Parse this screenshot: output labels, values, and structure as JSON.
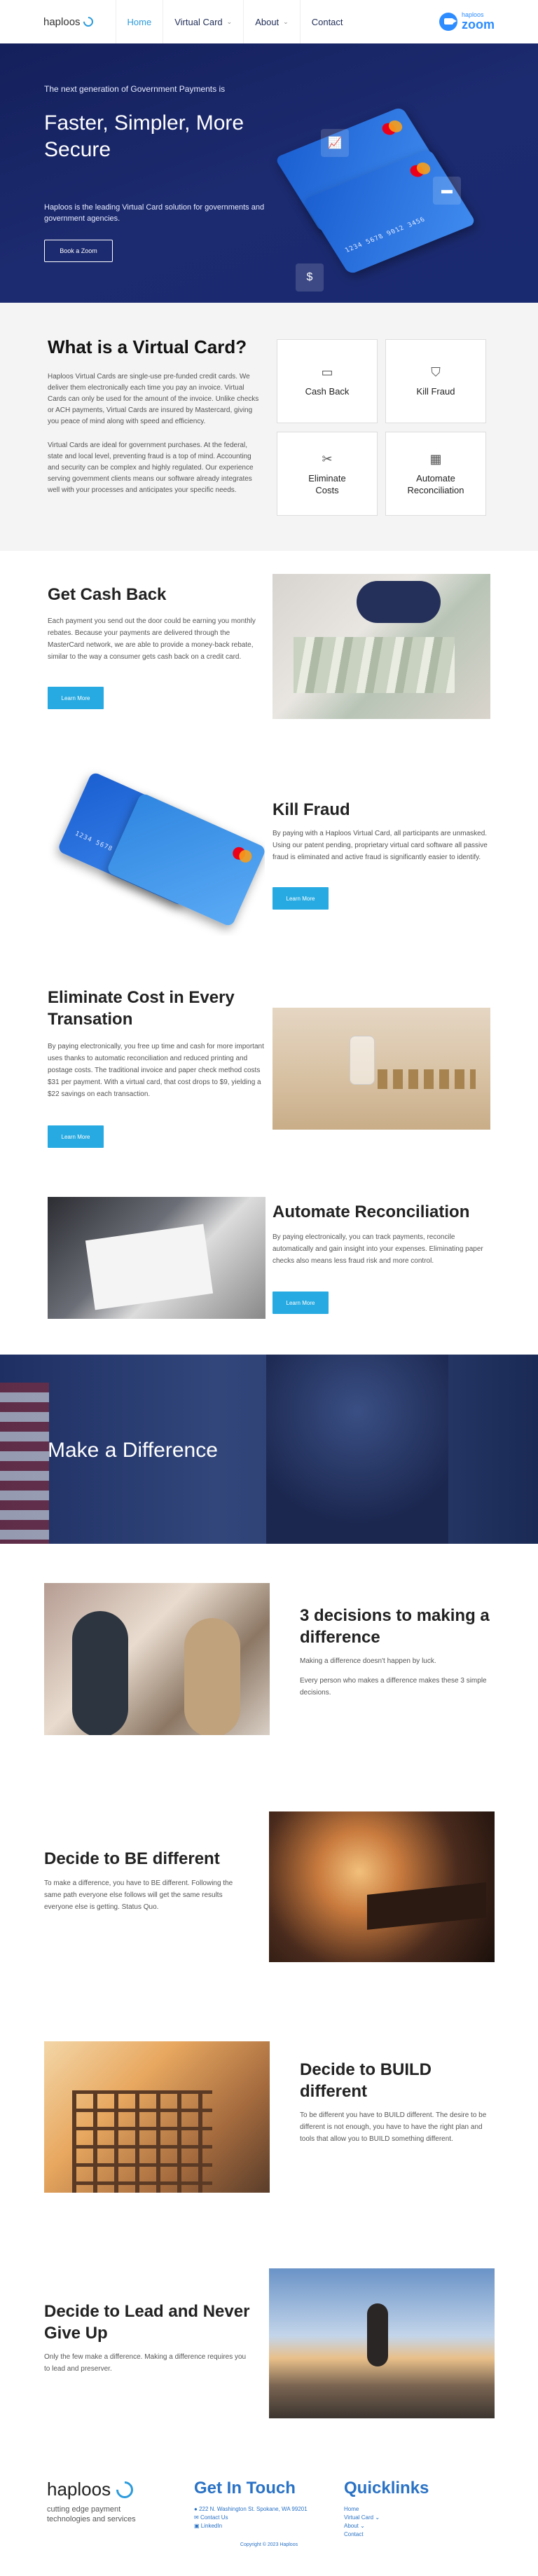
{
  "header": {
    "logo_text": "haploos",
    "nav": [
      {
        "label": "Home",
        "active": true,
        "dropdown": false
      },
      {
        "label": "Virtual Card",
        "active": false,
        "dropdown": true
      },
      {
        "label": "About",
        "active": false,
        "dropdown": true
      },
      {
        "label": "Contact",
        "active": false,
        "dropdown": false
      }
    ],
    "zoom": {
      "small": "haploos",
      "big": "zoom"
    }
  },
  "hero": {
    "eyebrow": "The next generation of Government Payments is",
    "title": "Faster, Simpler, More Secure",
    "description": "Haploos is the leading Virtual Card solution for governments and government agencies.",
    "button": "Book a Zoom",
    "card_number": "1234 5678 9012 3456"
  },
  "what": {
    "title": "What is a Virtual Card?",
    "p1": "Haploos Virtual Cards are single-use pre-funded credit cards. We deliver them electronically each time you pay an invoice. Virtual Cards can only be used for the amount of the invoice. Unlike checks or ACH payments, Virtual Cards are insured by Mastercard, giving you peace of mind along with speed and efficiency.",
    "p2": "Virtual Cards are ideal for government purchases. At the federal, state and local level, preventing fraud is a top of mind. Accounting and security can be complex and highly regulated. Our experience serving government clients means our software already integrates well with your processes and anticipates your specific needs.",
    "features": [
      {
        "label": "Cash Back",
        "icon": "card-icon"
      },
      {
        "label": "Kill Fraud",
        "icon": "shield-icon"
      },
      {
        "label": "Eliminate Costs",
        "icon": "scissors-icon"
      },
      {
        "label": "Automate Reconciliation",
        "icon": "ledger-icon"
      }
    ]
  },
  "cashback": {
    "title": "Get Cash Back",
    "text": "Each payment you send out the door could be earning you monthly rebates. Because your payments are delivered through the MasterCard network, we are able to provide a money-back rebate, similar to the way a consumer gets cash back on a credit card.",
    "button": "Learn More"
  },
  "fraud": {
    "title": "Kill Fraud",
    "text": "By paying with a Haploos Virtual Card, all participants are unmasked. Using our patent pending, proprietary virtual card software all passive fraud is eliminated and active fraud is significantly easier to identify.",
    "button": "Learn More"
  },
  "cost": {
    "title": "Eliminate Cost in Every Transation",
    "text": "By paying electronically, you free up time and cash for more important uses thanks to automatic reconciliation and reduced printing and postage costs. The traditional invoice and paper check method costs $31 per payment. With a virtual card, that cost drops to $9, yielding a $22 savings on each transaction.",
    "button": "Learn More"
  },
  "recon": {
    "title": "Automate Reconciliation",
    "text": "By paying electronically, you can track payments, reconcile automatically and gain insight into your expenses. Eliminating paper checks also means less fraud risk and more control.",
    "button": "Learn More"
  },
  "difference": {
    "title": "Make a Difference"
  },
  "decisions": {
    "title": "3 decisions to making a difference",
    "p1": "Making a difference doesn't happen by luck.",
    "p2": "Every person who makes a difference makes these 3 simple decisions."
  },
  "be": {
    "title": "Decide to BE different",
    "text": "To make a difference, you have to BE different. Following the same path everyone else follows will get the same results everyone else is getting. Status Quo."
  },
  "build": {
    "title": "Decide to BUILD different",
    "text": "To be different you have to BUILD different. The desire to be different is not enough, you have to have the right plan and tools that allow you to BUILD something different."
  },
  "lead": {
    "title": "Decide to Lead and Never Give Up",
    "text": "Only the few make a difference. Making a difference requires you to lead and preserver."
  },
  "footer": {
    "logo": "haploos",
    "tagline": "cutting edge payment technologies and services",
    "contact_title": "Get In Touch",
    "contact": [
      "222 N. Washington St. Spokane, WA 99201",
      "Contact Us",
      "LinkedIn"
    ],
    "links_title": "Quicklinks",
    "links": [
      "Home",
      "Virtual Card",
      "About",
      "Contact"
    ],
    "copyright": "Copyright © 2023 Haploos"
  },
  "colors": {
    "navy": "#14205b",
    "accent": "#27aae1",
    "link": "#2a72c5"
  }
}
